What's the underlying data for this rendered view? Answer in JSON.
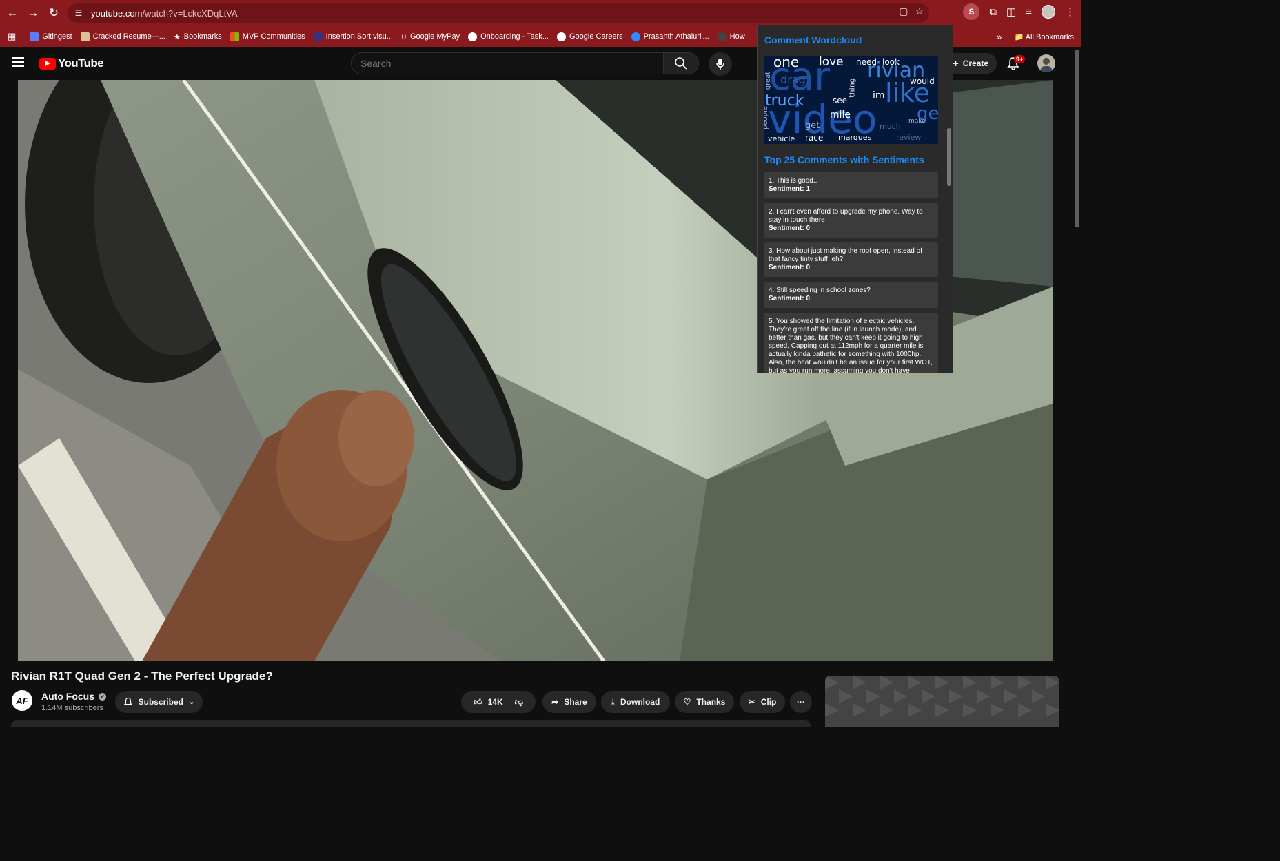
{
  "browser": {
    "url_host": "youtube.com",
    "url_path": "/watch?v=LckcXDqLtVA",
    "profile_initial": "S",
    "bookmarks": [
      {
        "label": "Gitingest",
        "color": "#5c7cff"
      },
      {
        "label": "Cracked Resume—...",
        "color": "#d9c29a"
      },
      {
        "label": "Bookmarks",
        "color": "#ffffff"
      },
      {
        "label": "MVP Communities",
        "color": "#f25022"
      },
      {
        "label": "Insertion Sort visu...",
        "color": "#3a2f7a"
      },
      {
        "label": "Google MyPay",
        "color": "#4285f4"
      },
      {
        "label": "Onboarding - Task...",
        "color": "#ffffff"
      },
      {
        "label": "Google Careers",
        "color": "#ffffff"
      },
      {
        "label": "Prasanth Athaluri'...",
        "color": "#2d8cff"
      },
      {
        "label": "How",
        "color": "#444444"
      }
    ],
    "more_bookmarks": "»",
    "all_bookmarks": "All Bookmarks"
  },
  "youtube": {
    "logo_text": "YouTube",
    "search_placeholder": "Search",
    "create_label": "Create",
    "notification_badge": "9+"
  },
  "popup": {
    "wordcloud_title": "Comment Wordcloud",
    "comments_title": "Top 25 Comments with Sentiments",
    "sentiment_label": "Sentiment:",
    "comments": [
      {
        "text": "1. This is good..",
        "sentiment": "1"
      },
      {
        "text": "2. I can't even afford to upgrade my phone. Way to stay in touch there",
        "sentiment": "0"
      },
      {
        "text": "3. How about just making the roof open, instead of that fancy tinty stuff, eh?",
        "sentiment": "0"
      },
      {
        "text": "4. Still speeding in school zones?",
        "sentiment": "0"
      },
      {
        "text": "5. You showed the limitation of electric vehicles. They're great off the line (if in launch mode), and better than gas, but they can't keep it going to high speed. Capping out at 112mph for a quarter mile is actually kinda pathetic for something with 1000hp. Also, the heat wouldn't be an issue for your first WOT, but as you run more, assuming you don't have",
        "sentiment": ""
      }
    ],
    "wordcloud_words": [
      {
        "w": "one",
        "c": "#ffffff"
      },
      {
        "w": "love",
        "c": "#ffffff"
      },
      {
        "w": "need",
        "c": "#ffffff"
      },
      {
        "w": "look",
        "c": "#ffffff"
      },
      {
        "w": "car",
        "c": "#1f4f9e"
      },
      {
        "w": "rivian",
        "c": "#3d7fd6"
      },
      {
        "w": "like",
        "c": "#2f6fc7"
      },
      {
        "w": "truck",
        "c": "#5aa0ff"
      },
      {
        "w": "video",
        "c": "#1f56b3"
      },
      {
        "w": "mile",
        "c": "#ffffff"
      },
      {
        "w": "see",
        "c": "#ffffff"
      },
      {
        "w": "im",
        "c": "#ffffff"
      },
      {
        "w": "would",
        "c": "#ffffff"
      },
      {
        "w": "gen",
        "c": "#2f6fc7"
      },
      {
        "w": "get",
        "c": "#9fb7e0"
      },
      {
        "w": "vehicle",
        "c": "#ffffff"
      },
      {
        "w": "race",
        "c": "#ffffff"
      },
      {
        "w": "marques",
        "c": "#ffffff"
      },
      {
        "w": "review",
        "c": "#4f6fa0"
      },
      {
        "w": "drag",
        "c": "#2f5fa8"
      },
      {
        "w": "people",
        "c": "#9fb7e0"
      },
      {
        "w": "great",
        "c": "#9fb7e0"
      },
      {
        "w": "thing",
        "c": "#ffffff"
      },
      {
        "w": "much",
        "c": "#4f6fa0"
      },
      {
        "w": "make",
        "c": "#9fb7e0"
      }
    ]
  },
  "video_page": {
    "title": "Rivian R1T Quad Gen 2 - The Perfect Upgrade?",
    "channel_logo": "AF",
    "channel_name": "Auto Focus",
    "subscribers": "1.14M subscribers",
    "subscribed_label": "Subscribed",
    "like_count": "14K",
    "share_label": "Share",
    "download_label": "Download",
    "thanks_label": "Thanks",
    "clip_label": "Clip",
    "more_label": "···"
  }
}
